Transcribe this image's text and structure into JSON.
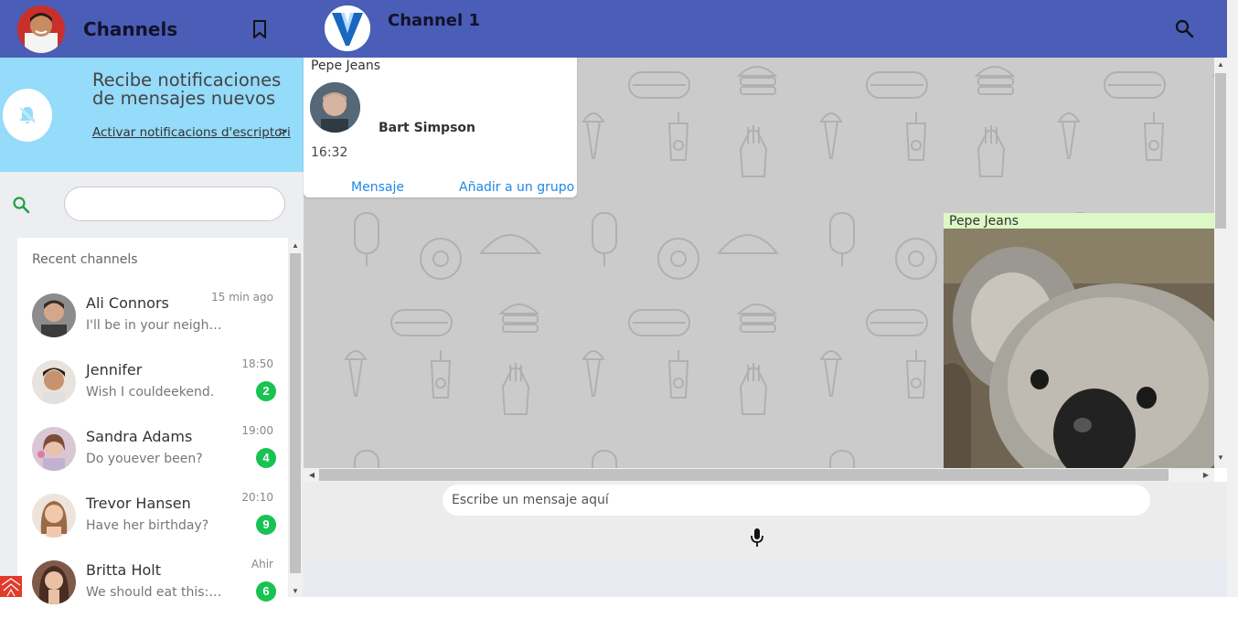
{
  "sidebar": {
    "title": "Channels",
    "icons": {
      "bookmark": "bookmark-outline-icon",
      "search": "magnifier-icon",
      "bell": "bell-off-icon"
    },
    "notification": {
      "title": "Recibe notificaciones de mensajes nuevos",
      "link": "Activar notificacions d'escriptori",
      "arrow": ">"
    },
    "search": {
      "placeholder": "",
      "value": ""
    },
    "recent_label": "Recent channels",
    "contacts": [
      {
        "name": "Ali Connors",
        "message": "I'll be in your neighborhood doing errands this weekend",
        "time": "15 min ago",
        "badge": ""
      },
      {
        "name": "Jennifer",
        "message": "Wish I couldeekend.",
        "time": "18:50",
        "badge": "2"
      },
      {
        "name": "Sandra Adams",
        "message": "Do youever been?",
        "time": "19:00",
        "badge": "4"
      },
      {
        "name": "Trevor Hansen",
        "message": "Have her birthday?",
        "time": "20:10",
        "badge": "9"
      },
      {
        "name": "Britta Holt",
        "message": "We should eat this: , S...",
        "time": "Ahir",
        "badge": "6"
      }
    ]
  },
  "chat": {
    "title": "Channel 1",
    "icons": {
      "search": "magnifier-icon",
      "mic": "microphone-icon"
    },
    "contact_card": {
      "sender": "Pepe Jeans",
      "contact_name": "Bart Simpson",
      "time": "16:32",
      "button_message": "Mensaje",
      "button_group": "Añadir a un grupo"
    },
    "image_message": {
      "sender": "Pepe Jeans"
    },
    "compose": {
      "placeholder": "Escribe un mensaje aquí",
      "value": ""
    }
  },
  "colors": {
    "header": "#4a5db7",
    "notification_banner": "#95dbfa",
    "badge": "#19c253",
    "chat_background": "#cbcbcb",
    "image_bubble": "#dcf8c6",
    "link": "#1e88e5"
  }
}
